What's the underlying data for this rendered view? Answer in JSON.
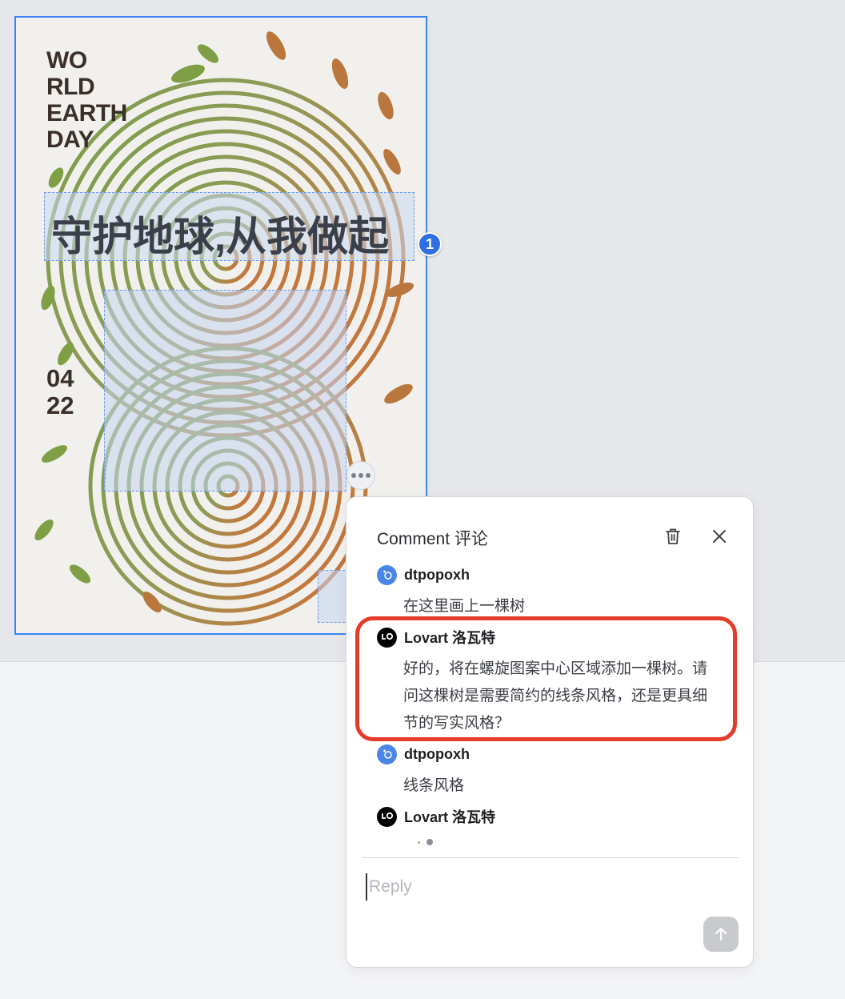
{
  "poster": {
    "wordmark": "WO\nRLD\nEARTH\nDAY",
    "headline": "守护地球,从我做起",
    "date": "04\n22"
  },
  "annotation": {
    "badge_number": "1"
  },
  "comment_panel": {
    "title": "Comment  评论",
    "delete_icon": "trash-icon",
    "close_icon": "close-icon",
    "messages": [
      {
        "author": "dtpopoxh",
        "avatar": "user-avatar-icon",
        "text": "在这里画上一棵树"
      },
      {
        "author": "Lovart  洛瓦特",
        "avatar": "lovart-logo-icon",
        "text": "好的，将在螺旋图案中心区域添加一棵树。请问这棵树是需要简约的线条风格，还是更具细节的写实风格？"
      },
      {
        "author": "dtpopoxh",
        "avatar": "user-avatar-icon",
        "text": "线条风格"
      },
      {
        "author": "Lovart  洛瓦特",
        "avatar": "lovart-logo-icon",
        "text": ""
      }
    ],
    "reply_placeholder": "Reply",
    "send_icon": "arrow-up-icon"
  },
  "colors": {
    "selection": "#3b82f6",
    "highlight": "#e53b2a",
    "badge": "#2f6fe4",
    "poster_bg": "#f1f0ec"
  }
}
